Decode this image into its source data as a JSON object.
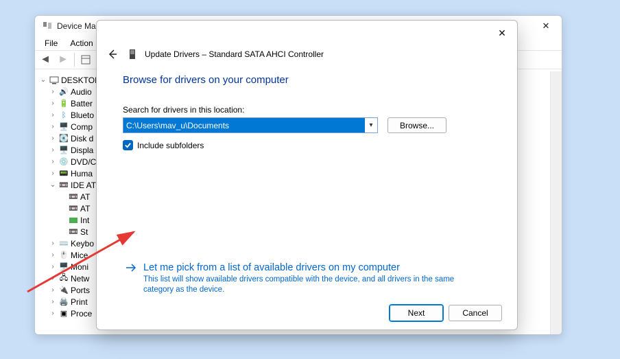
{
  "dm": {
    "title": "Device Manager",
    "menu": {
      "file": "File",
      "action": "Action",
      "unseen1": "",
      "unseen2": ""
    },
    "tree": {
      "root": "DESKTOP",
      "items": [
        "Audio",
        "Batter",
        "Blueto",
        "Comp",
        "Disk d",
        "Displa",
        "DVD/C",
        "Huma",
        "IDE AT",
        "AT",
        "AT",
        "Int",
        "St",
        "Keybo",
        "Mice",
        "Moni",
        "Netw",
        "Ports",
        "Print",
        "Proce"
      ]
    }
  },
  "dlg": {
    "header": "Update Drivers – Standard SATA AHCI Controller",
    "heading": "Browse for drivers on your computer",
    "field_label": "Search for drivers in this location:",
    "path_value": "C:\\Users\\mav_u\\Documents",
    "browse": "Browse...",
    "include_sub": "Include subfolders",
    "cl_title": "Let me pick from a list of available drivers on my computer",
    "cl_desc": "This list will show available drivers compatible with the device, and all drivers in the same category as the device.",
    "next": "Next",
    "cancel": "Cancel"
  }
}
